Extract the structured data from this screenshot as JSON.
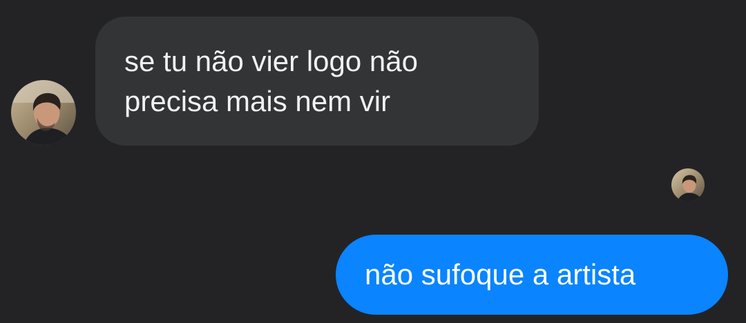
{
  "conversation": {
    "received": {
      "lines": [
        "se tu não vier logo não",
        "precisa mais nem vir"
      ],
      "avatar_icon": "contact-avatar-photo"
    },
    "read_receipt": {
      "avatar_icon": "seen-avatar-photo"
    },
    "sent": {
      "text": "não sufoque a artista",
      "bubble_color": "#0a84ff"
    }
  },
  "theme": {
    "background": "#232326",
    "received_bubble": "#333436",
    "text_color": "#f2f2f2"
  }
}
